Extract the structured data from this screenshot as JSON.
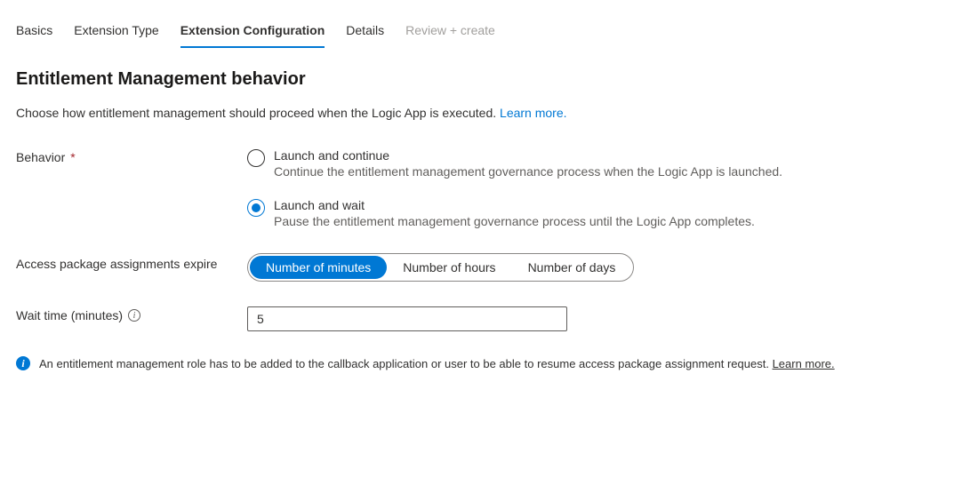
{
  "tabs": {
    "basics": "Basics",
    "extension_type": "Extension Type",
    "extension_configuration": "Extension Configuration",
    "details": "Details",
    "review_create": "Review + create"
  },
  "section": {
    "title": "Entitlement Management behavior",
    "description": "Choose how entitlement management should proceed when the Logic App is executed. ",
    "learn_more": "Learn more."
  },
  "behavior": {
    "label": "Behavior",
    "options": {
      "launch_continue": {
        "label": "Launch and continue",
        "desc": "Continue the entitlement management governance process when the Logic App is launched."
      },
      "launch_wait": {
        "label": "Launch and wait",
        "desc": "Pause the entitlement management governance process until the Logic App completes."
      }
    }
  },
  "expire": {
    "label": "Access package assignments expire",
    "options": {
      "minutes": "Number of minutes",
      "hours": "Number of hours",
      "days": "Number of days"
    }
  },
  "wait_time": {
    "label": "Wait time (minutes)",
    "value": "5"
  },
  "info": {
    "text": "An entitlement management role has to be added to the callback application or user to be able to resume access package assignment request. ",
    "learn_more": "Learn more."
  }
}
